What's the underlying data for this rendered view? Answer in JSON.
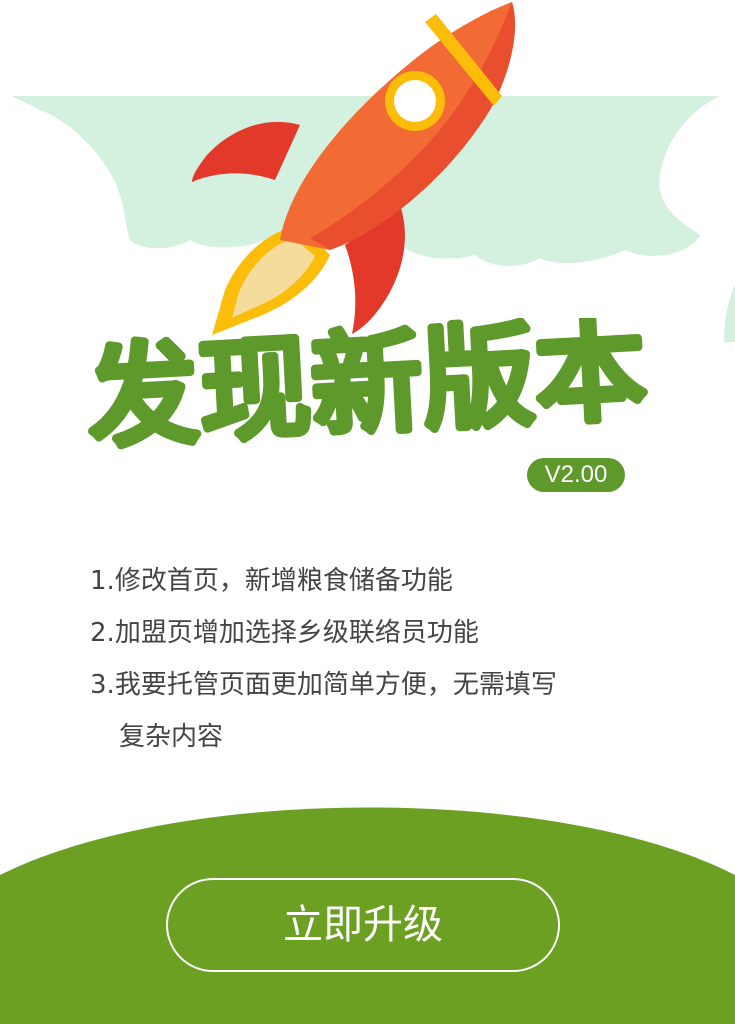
{
  "headline": "发现新版本",
  "version": "V2.00",
  "release_notes": [
    {
      "number": "1.",
      "text": "修改首页，新增粮食储备功能",
      "continuation": ""
    },
    {
      "number": "2.",
      "text": "加盟页增加选择乡级联络员功能",
      "continuation": ""
    },
    {
      "number": "3.",
      "text": "我要托管页面更加简单方便，无需填写",
      "continuation": "复杂内容"
    }
  ],
  "upgrade_button_label": "立即升级",
  "colors": {
    "cloud": "#d4f0df",
    "green": "#5e9a2b",
    "footer_green": "#6ba023",
    "rocket_body": "#f26a34",
    "rocket_fin": "#e2392a",
    "rocket_band": "#fbbc0a",
    "flame": "#f5dc9c"
  },
  "icons": {
    "rocket": "rocket-icon",
    "cloud": "cloud-background"
  }
}
